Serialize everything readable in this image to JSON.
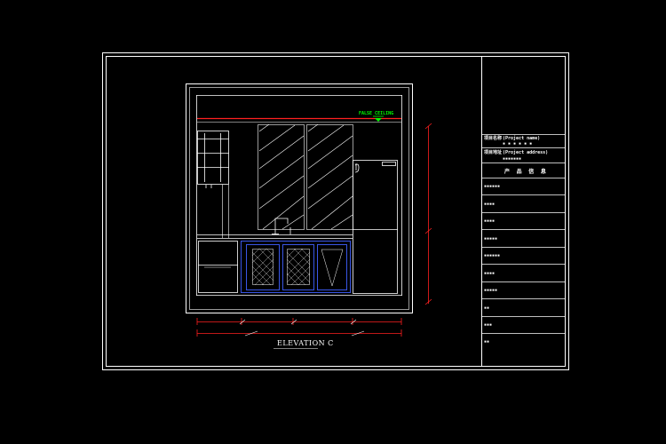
{
  "drawing": {
    "ceiling_label": "FALSE CEILING",
    "elevation_title": "ELEVATION C"
  },
  "title_block": {
    "project_name_label": "项目名称",
    "project_name_value": "(Project name)",
    "project_name_sub": "▪ ▪ ▪ ▪ ▪ ▪",
    "project_address_label": "项目地址",
    "project_address_value": "(Project address)",
    "project_address_sub": "▪▪▪▪▪▪▪",
    "header": "产 品 信 息",
    "rows": [
      "▪▪▪▪▪▪",
      "▪▪▪▪",
      "▪▪▪▪",
      "▪▪▪▪▪",
      "▪▪▪▪▪▪",
      "▪▪▪▪",
      "▪▪▪▪▪",
      "▪▪",
      "▪▪▪",
      "▪▪"
    ]
  },
  "colors": {
    "background": "#000000",
    "line": "#ffffff",
    "dim_red": "#ff2020",
    "ceiling_green": "#00ff00",
    "cabinet_blue": "#4060ff"
  }
}
